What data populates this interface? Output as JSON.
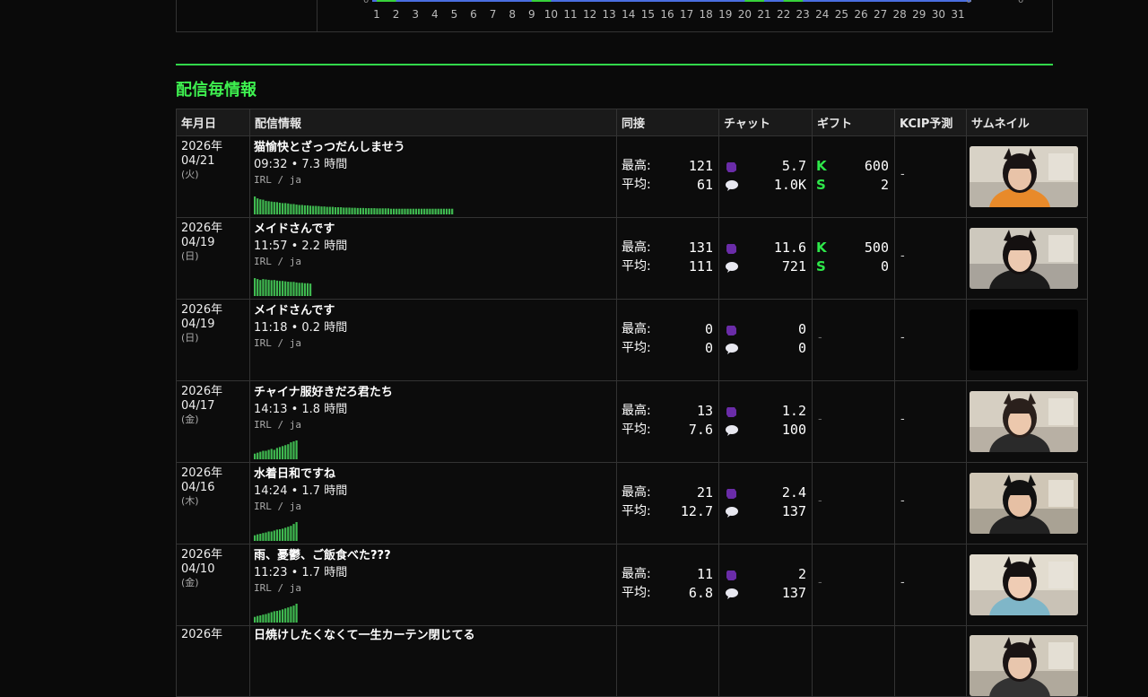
{
  "top_chart": {
    "axis_labels": [
      "1",
      "2",
      "3",
      "4",
      "5",
      "6",
      "7",
      "8",
      "9",
      "10",
      "11",
      "12",
      "13",
      "14",
      "15",
      "16",
      "17",
      "18",
      "19",
      "20",
      "21",
      "22",
      "23",
      "24",
      "25",
      "26",
      "27",
      "28",
      "29",
      "30",
      "31"
    ],
    "zero_left": "0",
    "zero_right": "0",
    "zero_far": "0",
    "colors": {
      "blue": "#4a6ee0",
      "green": "#38d13a"
    }
  },
  "section": {
    "title": "配信毎情報"
  },
  "table": {
    "headers": {
      "date": "年月日",
      "info": "配信情報",
      "concurrent": "同接",
      "chat": "チャット",
      "gift": "ギフト",
      "kcip": "KCIP予測",
      "thumbnail": "サムネイル"
    },
    "labels": {
      "max": "最高:",
      "avg": "平均:",
      "gift_k": "K",
      "gift_s": "S",
      "dash": "-"
    },
    "rows": [
      {
        "year": "2026年",
        "md": "04/21",
        "dow": "(火)",
        "title": "猫愉快とざっつだんしませう",
        "meta": "09:32 • 7.3 時間",
        "lang": "IRL / ja",
        "max": "121",
        "avg": "61",
        "chat_max": "5.7",
        "chat_avg": "1.0K",
        "gift_k": "600",
        "gift_s": "2",
        "kcip": "-",
        "thumb": "thumb-1",
        "spark": [
          0.95,
          0.85,
          0.8,
          0.78,
          0.72,
          0.7,
          0.68,
          0.66,
          0.65,
          0.62,
          0.6,
          0.6,
          0.58,
          0.55,
          0.55,
          0.52,
          0.5,
          0.5,
          0.48,
          0.48,
          0.46,
          0.45,
          0.45,
          0.44,
          0.42,
          0.42,
          0.4,
          0.4,
          0.4,
          0.38,
          0.38,
          0.38,
          0.36,
          0.36,
          0.36,
          0.35,
          0.35,
          0.34,
          0.34,
          0.34,
          0.33,
          0.33,
          0.33,
          0.33,
          0.32,
          0.32,
          0.32,
          0.32,
          0.32,
          0.3,
          0.3,
          0.3,
          0.3,
          0.3,
          0.3,
          0.3,
          0.3,
          0.3,
          0.3,
          0.3,
          0.3,
          0.3,
          0.3,
          0.3,
          0.3,
          0.3,
          0.3,
          0.3,
          0.3,
          0.3,
          0.3,
          0.3
        ]
      },
      {
        "year": "2026年",
        "md": "04/19",
        "dow": "(日)",
        "title": "メイドさんです",
        "meta": "11:57 • 2.2 時間",
        "lang": "IRL / ja",
        "max": "131",
        "avg": "111",
        "chat_max": "11.6",
        "chat_avg": "721",
        "gift_k": "500",
        "gift_s": "0",
        "kcip": "-",
        "thumb": "thumb-2",
        "spark": [
          0.95,
          0.9,
          0.85,
          0.9,
          0.88,
          0.86,
          0.84,
          0.85,
          0.82,
          0.8,
          0.8,
          0.78,
          0.76,
          0.75,
          0.75,
          0.72,
          0.7,
          0.7,
          0.68,
          0.68,
          0.66
        ]
      },
      {
        "year": "2026年",
        "md": "04/19",
        "dow": "(日)",
        "title": "メイドさんです",
        "meta": "11:18 • 0.2 時間",
        "lang": "IRL / ja",
        "max": "0",
        "avg": "0",
        "chat_max": "0",
        "chat_avg": "0",
        "gift_k": "",
        "gift_s": "",
        "kcip": "-",
        "thumb": "empty",
        "spark": []
      },
      {
        "year": "2026年",
        "md": "04/17",
        "dow": "(金)",
        "title": "チャイナ服好きだろ君たち",
        "meta": "14:13 • 1.8 時間",
        "lang": "IRL / ja",
        "max": "13",
        "avg": "7.6",
        "chat_max": "1.2",
        "chat_avg": "100",
        "gift_k": "",
        "gift_s": "",
        "kcip": "-",
        "thumb": "thumb-3",
        "spark": [
          0.3,
          0.35,
          0.4,
          0.45,
          0.45,
          0.5,
          0.55,
          0.5,
          0.6,
          0.65,
          0.7,
          0.75,
          0.8,
          0.9,
          0.95,
          1.0
        ]
      },
      {
        "year": "2026年",
        "md": "04/16",
        "dow": "(木)",
        "title": "水着日和ですね",
        "meta": "14:24 • 1.7 時間",
        "lang": "IRL / ja",
        "max": "21",
        "avg": "12.7",
        "chat_max": "2.4",
        "chat_avg": "137",
        "gift_k": "",
        "gift_s": "",
        "kcip": "-",
        "thumb": "thumb-4",
        "spark": [
          0.3,
          0.35,
          0.38,
          0.42,
          0.45,
          0.5,
          0.5,
          0.55,
          0.6,
          0.62,
          0.65,
          0.7,
          0.75,
          0.8,
          0.9,
          1.0
        ]
      },
      {
        "year": "2026年",
        "md": "04/10",
        "dow": "(金)",
        "title": "雨、憂鬱、ご飯食べた???",
        "meta": "11:23 • 1.7 時間",
        "lang": "IRL / ja",
        "max": "11",
        "avg": "6.8",
        "chat_max": "2",
        "chat_avg": "137",
        "gift_k": "",
        "gift_s": "",
        "kcip": "-",
        "thumb": "thumb-5",
        "spark": [
          0.3,
          0.35,
          0.38,
          0.42,
          0.45,
          0.5,
          0.55,
          0.6,
          0.62,
          0.65,
          0.7,
          0.75,
          0.8,
          0.85,
          0.9,
          1.0
        ]
      },
      {
        "year": "2026年",
        "md": "",
        "dow": "",
        "title": "日焼けしたくなくて一生カーテン閉じてる",
        "meta": "",
        "lang": "",
        "max": "",
        "avg": "",
        "chat_max": "",
        "chat_avg": "",
        "gift_k": "",
        "gift_s": "",
        "kcip": "",
        "thumb": "thumb-6",
        "spark": []
      }
    ]
  }
}
